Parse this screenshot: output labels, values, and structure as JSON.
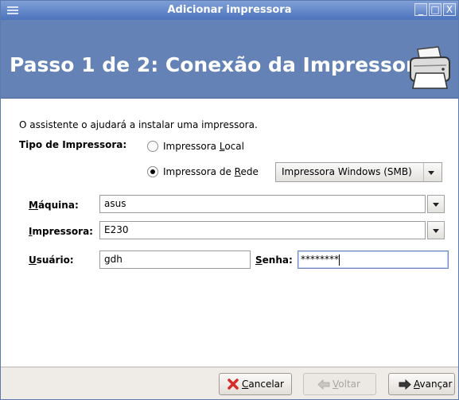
{
  "window": {
    "title": "Adicionar impressora",
    "buttons": {
      "minimize": "_",
      "maximize": "□",
      "close": "X"
    }
  },
  "header": {
    "title": "Passo 1 de 2: Conexão da Impressora",
    "icon": "printer-icon"
  },
  "intro": "O assistente o ajudará a instalar uma impressora.",
  "printer_type": {
    "label": "Tipo de Impressora:",
    "local": {
      "prefix": "Impressora ",
      "mnemonic": "L",
      "suffix": "ocal",
      "selected": false
    },
    "network": {
      "prefix": "Impressora de ",
      "mnemonic": "R",
      "suffix": "ede",
      "selected": true
    },
    "network_type_value": "Impressora Windows (SMB)"
  },
  "host": {
    "mnemonic": "M",
    "label_rest": "áquina:",
    "value": "asus"
  },
  "printer": {
    "mnemonic": "I",
    "label_rest": "mpressora:",
    "value": "E230"
  },
  "user": {
    "mnemonic": "U",
    "label_rest": "suário:",
    "value": "gdh"
  },
  "password": {
    "mnemonic": "S",
    "label_rest": "enha:",
    "value": "********"
  },
  "footer": {
    "cancel": {
      "mnemonic": "C",
      "rest": "ancelar",
      "icon": "cancel-x-icon",
      "enabled": true
    },
    "back": {
      "mnemonic": "V",
      "rest": "oltar",
      "icon": "back-arrow-icon",
      "enabled": false
    },
    "next": {
      "mnemonic": "A",
      "rest": "vançar",
      "icon": "forward-arrow-icon",
      "enabled": true
    }
  },
  "colors": {
    "titlebar": "#5a7fc6",
    "header_band": "#6482b5",
    "dialog_bg": "#efebe7",
    "cancel_icon": "#d42b2b"
  }
}
